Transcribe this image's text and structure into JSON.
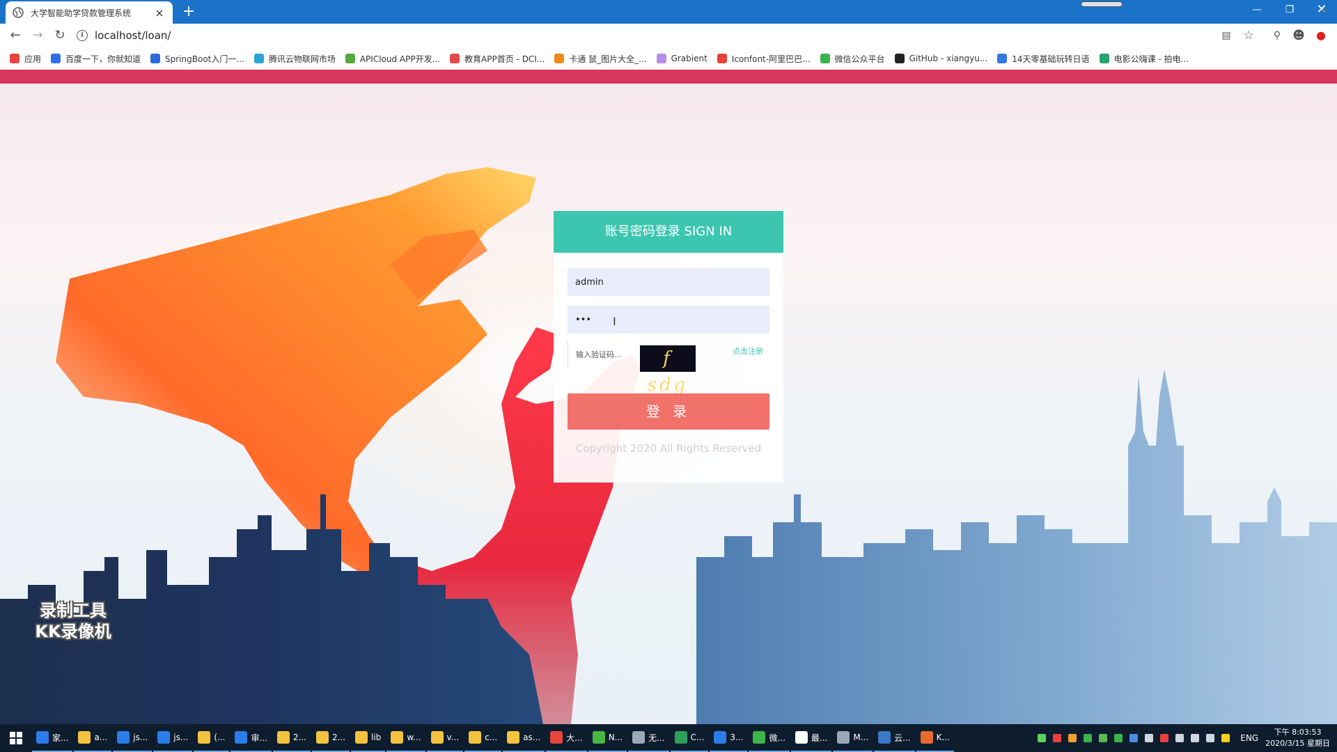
{
  "browser": {
    "tab_title": "大学智能助学贷款管理系统",
    "tab_close": "×",
    "new_tab": "+",
    "url": "localhost/loan/",
    "info_icon": "i"
  },
  "bookmarks": [
    {
      "label": "应用",
      "icon": "apps-grid-icon",
      "color": "#e8453c"
    },
    {
      "label": "百度一下，你就知道",
      "icon": "baidu-paw-icon",
      "color": "#2f6fe4"
    },
    {
      "label": "SpringBoot入门一...",
      "icon": "springboot-icon",
      "color": "#2d6bd9"
    },
    {
      "label": "腾讯云物联网市场",
      "icon": "tencent-cloud-icon",
      "color": "#2aa3d6"
    },
    {
      "label": "APICloud APP开发...",
      "icon": "apicloud-icon",
      "color": "#57a73a"
    },
    {
      "label": "教育APP首页 - DCI...",
      "icon": "play-outline-icon",
      "color": "#e24a4a"
    },
    {
      "label": "卡通 鼠_图片大全_...",
      "icon": "letter-a-icon",
      "color": "#f08a1a"
    },
    {
      "label": "Grabient",
      "icon": "grabient-icon",
      "color": "#b98ce6"
    },
    {
      "label": "Iconfont-阿里巴巴...",
      "icon": "iconfont-icon",
      "color": "#e5423b"
    },
    {
      "label": "微信公众平台",
      "icon": "wechat-icon",
      "color": "#3bb54a"
    },
    {
      "label": "GitHub - xiangyu...",
      "icon": "github-icon",
      "color": "#222222"
    },
    {
      "label": "14天零基础玩转日语",
      "icon": "book-icon",
      "color": "#3577e0"
    },
    {
      "label": "电影公嗨课 - 拍电...",
      "icon": "letter-e-icon",
      "color": "#27a36b"
    }
  ],
  "bookmarks_more": "»",
  "login": {
    "header": "账号密码登录 SIGN IN",
    "username_value": "admin",
    "password_value": "•••",
    "captcha_placeholder": "输入验证码...",
    "captcha_text": "f sdg",
    "register_link": "点击注册",
    "submit_label": "登 录",
    "copyright": "Copyright 2020 All Rights Reserved"
  },
  "watermark": {
    "line1": "录制工具",
    "line2": "KK录像机"
  },
  "taskbar": {
    "items": [
      {
        "label": "家...",
        "color": "#2b7de9"
      },
      {
        "label": "a...",
        "color": "#f3c23e"
      },
      {
        "label": "js...",
        "color": "#2b7de9"
      },
      {
        "label": "js...",
        "color": "#2b7de9"
      },
      {
        "label": "(...",
        "color": "#f3c23e"
      },
      {
        "label": "审...",
        "color": "#2b7de9"
      },
      {
        "label": "2...",
        "color": "#f3c23e"
      },
      {
        "label": "2...",
        "color": "#f3c23e"
      },
      {
        "label": "lib",
        "color": "#f3c23e"
      },
      {
        "label": "w...",
        "color": "#f3c23e"
      },
      {
        "label": "v...",
        "color": "#f3c23e"
      },
      {
        "label": "c...",
        "color": "#f3c23e"
      },
      {
        "label": "as...",
        "color": "#f3c23e"
      },
      {
        "label": "大...",
        "color": "#e8453c"
      },
      {
        "label": "N...",
        "color": "#48b63f"
      },
      {
        "label": "无...",
        "color": "#9aa8b8"
      },
      {
        "label": "C...",
        "color": "#2f9e5b"
      },
      {
        "label": "3...",
        "color": "#2b7de9"
      },
      {
        "label": "微...",
        "color": "#3bb54a"
      },
      {
        "label": "最...",
        "color": "#ffffff"
      },
      {
        "label": "M...",
        "color": "#9aa8b8"
      },
      {
        "label": "云...",
        "color": "#3b78c6"
      },
      {
        "label": "K...",
        "color": "#e76a2e"
      }
    ],
    "language": "ENG",
    "time": "下午 8:03:53",
    "date": "2020/3/15 星期日"
  }
}
